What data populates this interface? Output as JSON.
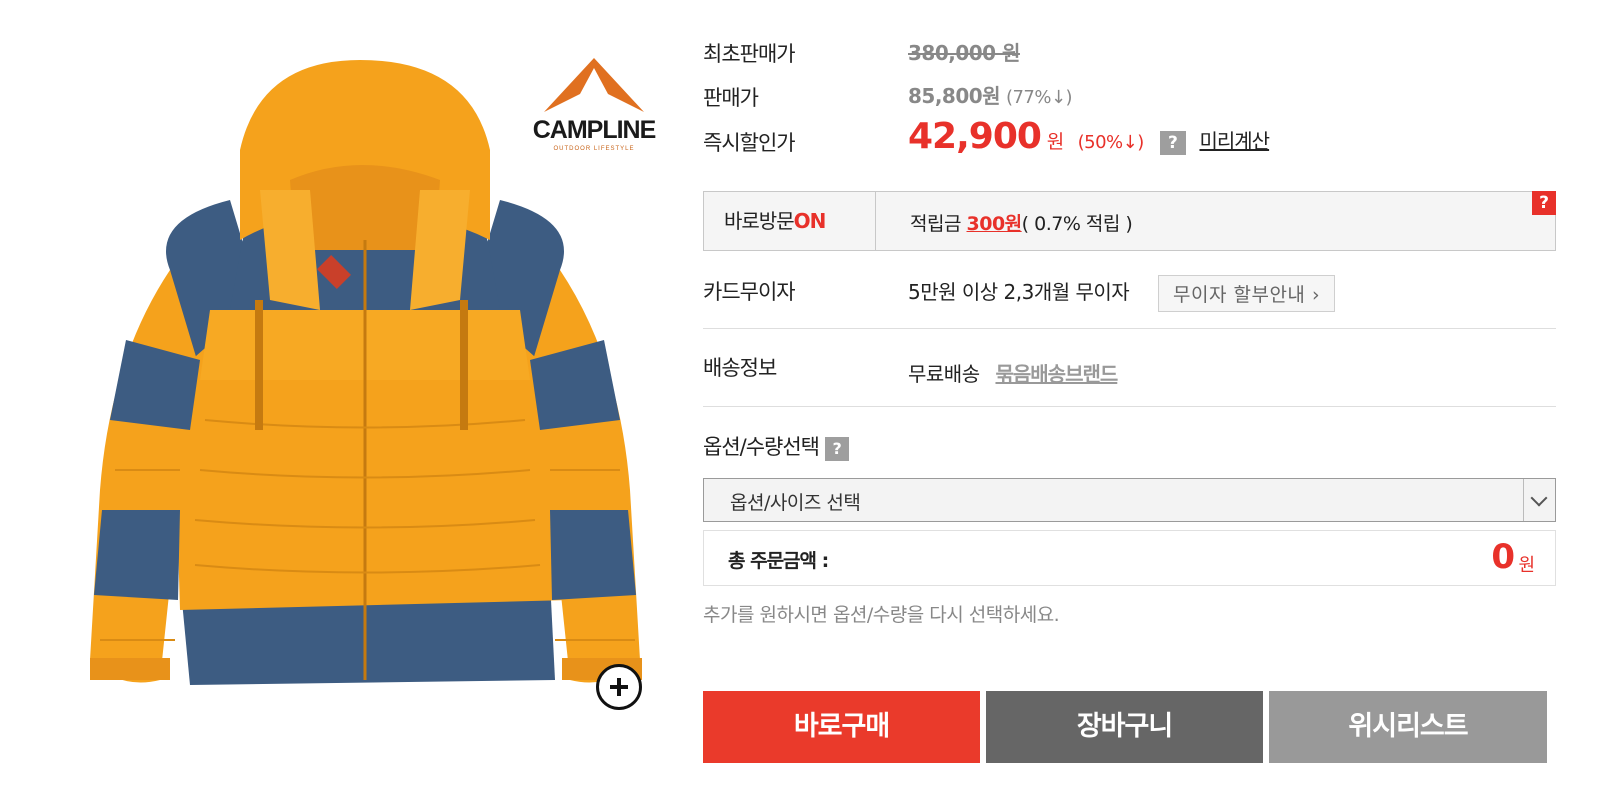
{
  "brand": {
    "name": "CAMPLINE",
    "tagline": "OUTDOOR LIFESTYLE"
  },
  "price": {
    "original_label": "최초판매가",
    "original_value": "380,000 원",
    "sale_label": "판매가",
    "sale_value": "85,800원",
    "sale_rate": "(77%↓)",
    "instant_label": "즉시할인가",
    "instant_value": "42,900",
    "instant_unit": "원",
    "instant_rate": "(50%↓)",
    "help_icon": "?",
    "preview_link": "미리계산"
  },
  "visit": {
    "label_prefix": "바로방문",
    "label_on": "ON",
    "points_prefix": "적립금",
    "points_value": "300원",
    "points_suffix": "( 0.7% 적립 )",
    "help_icon": "?"
  },
  "card": {
    "label": "카드무이자",
    "text": "5만원 이상 2,3개월 무이자",
    "button": "무이자 할부안내 ›"
  },
  "shipping": {
    "label": "배송정보",
    "text": "무료배송",
    "link": "묶음배송브랜드"
  },
  "options": {
    "label": "옵션/수량선택",
    "help_icon": "?",
    "select_value": "옵션/사이즈 선택"
  },
  "total": {
    "label": "총 주문금액 :",
    "amount": "0",
    "unit": "원"
  },
  "hint": "추가를 원하시면 옵션/수량을 다시 선택하세요.",
  "actions": {
    "buy": "바로구매",
    "cart": "장바구니",
    "wishlist": "위시리스트"
  },
  "colors": {
    "accent": "#e8312a",
    "jacket_orange": "#f5a21c",
    "jacket_navy": "#3d5c82"
  }
}
